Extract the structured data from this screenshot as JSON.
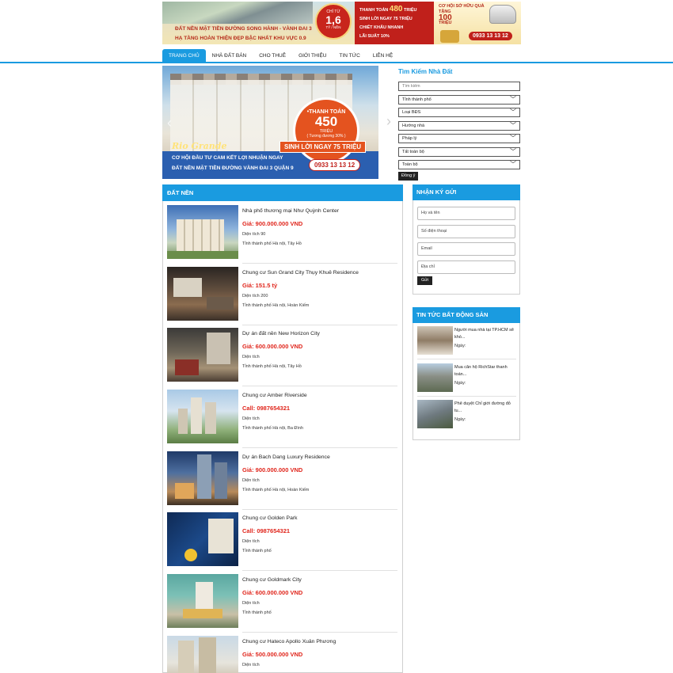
{
  "banner": {
    "line1": "ĐẤT NỀN MẶT TIỀN ĐƯỜNG SONG HÀNH - VÀNH ĐAI 3",
    "line2": "HẠ TẦNG HOÀN THIỆN ĐẸP BẬC NHẤT KHU VỰC 0.9",
    "price_small": "CHỈ TỪ",
    "price_big": "1,6",
    "price_unit": "TỶ / NỀN",
    "mid_1_label": "THANH TOÁN",
    "mid_1_value": "480",
    "mid_1_unit": "TRIỆU",
    "mid_2": "SINH LỜI NGAY 75 TRIỆU",
    "mid_3": "CHIẾT KHẤU NHANH",
    "mid_4": "LÃI SUẤT 10%",
    "gift_title": "CƠ HỘI SỞ HỮU QUÀ TẶNG",
    "gift_value": "100",
    "gift_unit": "TRIỆU",
    "phone": "0933 13 13 12"
  },
  "nav": {
    "items": [
      "TRANG CHỦ",
      "NHÀ ĐẤT BÁN",
      "CHO THUÊ",
      "GIỚI THIỆU",
      "TIN TỨC",
      "LIÊN HỆ"
    ]
  },
  "slider": {
    "badge_1": "•THANH TOÁN",
    "badge_2": "450",
    "badge_3": "TRIỆU",
    "badge_4": "( Tương đương 30% )",
    "sinh_loi": "SINH LỜI NGAY 75 TRIỆU",
    "brand": "Rio Grande",
    "line1": "CƠ HỘI ĐẦU TƯ CAM KẾT LỢI NHUẬN NGAY",
    "line2": "ĐẤT NỀN MẶT TIỀN ĐƯỜNG VÀNH ĐAI 3 QUẬN 9",
    "phone": "0933 13 13 12"
  },
  "search": {
    "title": "Tìm Kiếm Nhà Đất",
    "placeholder": "Tìm kiếm",
    "selects": [
      "Tỉnh thành phố",
      "Loại BĐS",
      "Hướng nhà",
      "Pháp lý",
      "Tất toán bộ",
      "Toàn bộ"
    ],
    "button": "Đồng ý"
  },
  "main": {
    "heading": "ĐẤT NỀN",
    "items": [
      {
        "title": "Nhà phố thương mại Như Quỳnh Center",
        "price": "Giá: 900.000.000 VND",
        "area": "Diện tích 90",
        "location": "Tỉnh thành phố Hà nội, Tây Hồ"
      },
      {
        "title": "Chung cư Sun Grand City Thụy Khuê Residence",
        "price": "Giá: 151.5 tỷ",
        "area": "Diện tích 200",
        "location": "Tỉnh thành phố Hà nội, Hoàn Kiếm"
      },
      {
        "title": "Dự án đất nền New Horizon City",
        "price": "Giá: 600.000.000 VND",
        "area": "Diện tích",
        "location": "Tỉnh thành phố Hà nội, Tây Hồ"
      },
      {
        "title": "Chung cư Amber Riverside",
        "price": "Call: 0987654321",
        "area": "Diện tích",
        "location": "Tỉnh thành phố Hà nội, Ba Đình"
      },
      {
        "title": "Dự án Bach Dang Luxury Residence",
        "price": "Giá: 900.000.000 VND",
        "area": "Diện tích",
        "location": "Tỉnh thành phố Hà nội, Hoàn Kiếm"
      },
      {
        "title": "Chung cư Golden Park",
        "price": "Call: 0987654321",
        "area": "Diện tích",
        "location": "Tỉnh thành phố"
      },
      {
        "title": "Chung cư Goldmark City",
        "price": "Giá: 600.000.000 VND",
        "area": "Diện tích",
        "location": "Tỉnh thành phố"
      },
      {
        "title": "Chung cư Hateco Apollo Xuân Phương",
        "price": "Giá: 500.000.000 VND",
        "area": "Diện tích",
        "location": ""
      }
    ]
  },
  "consign": {
    "heading": "NHẬN KÝ GỬI",
    "fields": [
      "Họ và tên",
      "Số điện thoại",
      "Email",
      "Địa chỉ"
    ],
    "button": "Gửi"
  },
  "news": {
    "heading": "TIN TỨC BẤT ĐỘNG SẢN",
    "items": [
      {
        "title": "Người mua nhà tại TP.HCM sẽ khó...",
        "date": "Ngày:"
      },
      {
        "title": "Mua căn hộ RichStar thanh toán...",
        "date": "Ngày:"
      },
      {
        "title": "Phê duyệt Chỉ giới đường đỏ tu...",
        "date": "Ngày:"
      }
    ]
  },
  "colors": {
    "accent": "#1a9be0",
    "price": "#e0251b",
    "banner_red": "#c0201b"
  }
}
